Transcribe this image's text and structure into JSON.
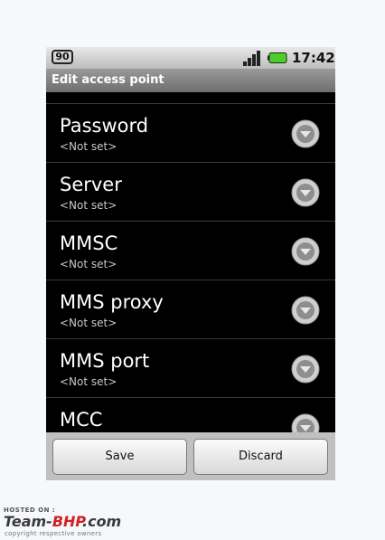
{
  "statusbar": {
    "notification_badge": "90",
    "time": "17:42",
    "icons": [
      "signal-icon",
      "battery-icon"
    ],
    "battery_color": "#4bd02a"
  },
  "title": "Edit access point",
  "items": [
    {
      "title": "Password",
      "value": "<Not set>"
    },
    {
      "title": "Server",
      "value": "<Not set>"
    },
    {
      "title": "MMSC",
      "value": "<Not set>"
    },
    {
      "title": "MMS proxy",
      "value": "<Not set>"
    },
    {
      "title": "MMS port",
      "value": "<Not set>"
    },
    {
      "title": "MCC",
      "value": ""
    }
  ],
  "buttons": {
    "save": "Save",
    "discard": "Discard"
  },
  "watermark": {
    "hosted": "HOSTED ON :",
    "logo_a": "Team-",
    "logo_b": "BHP",
    "logo_c": ".com",
    "copyright": "copyright respective owners"
  }
}
